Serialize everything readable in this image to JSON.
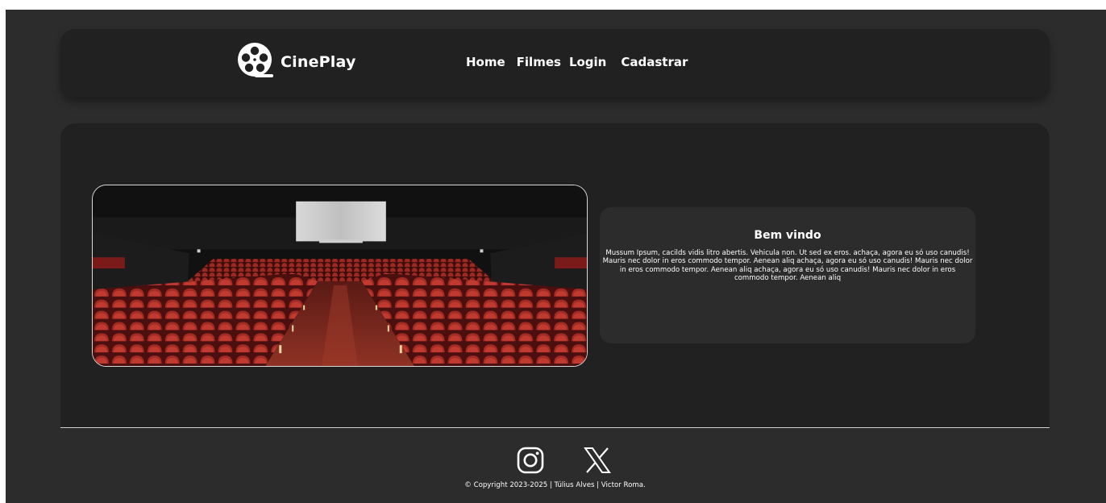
{
  "brand": {
    "name": "CinePlay",
    "logo_icon": "film-reel-icon"
  },
  "nav": {
    "items": [
      {
        "label": "Home"
      },
      {
        "label": "Filmes"
      },
      {
        "label": "Login"
      },
      {
        "label": "Cadastrar"
      }
    ]
  },
  "hero": {
    "image": "cinema-theater-image"
  },
  "welcome": {
    "title": "Bem vindo",
    "text": "Mussum Ipsum, cacilds vidis litro abertis. Vehicula non. Ut sed ex eros. achaça, agora eu só uso canudis! Mauris nec dolor in eros commodo tempor. Aenean aliq achaça, agora eu só uso canudis! Mauris nec dolor in eros commodo tempor. Aenean aliq achaça, agora eu só uso canudis! Mauris nec dolor in eros commodo tempor. Aenean aliq"
  },
  "footer": {
    "social": [
      {
        "icon": "instagram-icon"
      },
      {
        "icon": "x-twitter-icon"
      }
    ],
    "copyright": "© Copyright 2023-2025 | Túlius Alves | Victor Roma."
  },
  "colors": {
    "page_background": "#2b2c2b",
    "card_background": "#212121",
    "text": "#ffffff"
  }
}
